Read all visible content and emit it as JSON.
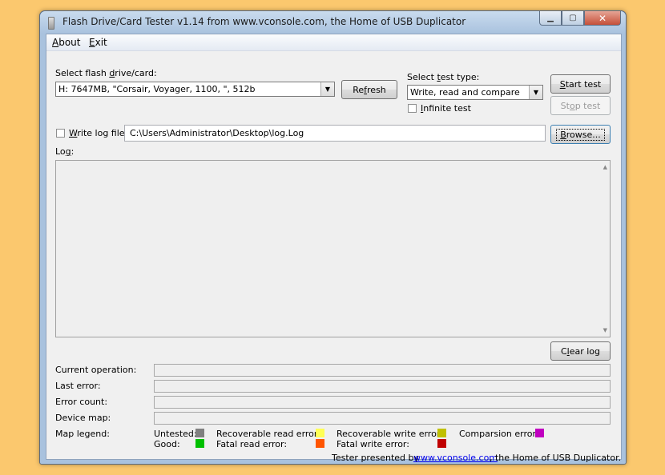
{
  "window": {
    "title": "Flash Drive/Card Tester v1.14 from www.vconsole.com, the Home of USB Duplicator",
    "minimize_glyph": "▁",
    "maximize_glyph": "▢",
    "close_glyph": "✕"
  },
  "menu": {
    "about_ak": "A",
    "about_rest": "bout",
    "exit_ak": "E",
    "exit_rest": "xit"
  },
  "drive": {
    "label_pre": "Select flash ",
    "label_ak": "d",
    "label_post": "rive/card:",
    "selected": "H: 7647MB, \"Corsair, Voyager, 1100, \", 512b",
    "refresh_pre": "Re",
    "refresh_ak": "f",
    "refresh_post": "resh"
  },
  "test_type": {
    "label_pre": "Select ",
    "label_ak": "t",
    "label_post": "est type:",
    "selected": "Write, read and compare",
    "infinite_ak": "I",
    "infinite_rest": "nfinite test"
  },
  "actions": {
    "start_ak": "S",
    "start_rest": "tart test",
    "stop_pre": "St",
    "stop_ak": "o",
    "stop_post": "p test"
  },
  "logfile": {
    "write_ak": "W",
    "write_rest": "rite log file",
    "path": "C:\\Users\\Administrator\\Desktop\\log.Log",
    "browse_ak": "B",
    "browse_rest": "rowse..."
  },
  "log": {
    "label_pre": "Lo",
    "label_ak": "g",
    "label_post": ":",
    "clear_pre": "C",
    "clear_ak": "l",
    "clear_post": "ear log"
  },
  "status": {
    "current_operation": "Current operation:",
    "last_error": "Last error:",
    "error_count": "Error count:",
    "device_map": "Device map:"
  },
  "legend": {
    "title": "Map legend:",
    "untested": "Untested:",
    "good": "Good:",
    "recoverable_read": "Recoverable read error:",
    "fatal_read": "Fatal read error:",
    "recoverable_write": "Recoverable write error:",
    "fatal_write": "Fatal write error:",
    "comparison": "Comparsion error:",
    "colors": {
      "untested": "#808080",
      "good": "#00c000",
      "recoverable_read": "#ffff55",
      "fatal_read": "#ff5500",
      "recoverable_write": "#c0c000",
      "fatal_write": "#c00000",
      "comparison": "#c000c0"
    }
  },
  "footer": {
    "prefix": "Tester presented by ",
    "link": "www.vconsole.com",
    "suffix": " , the Home of USB Duplicator."
  }
}
